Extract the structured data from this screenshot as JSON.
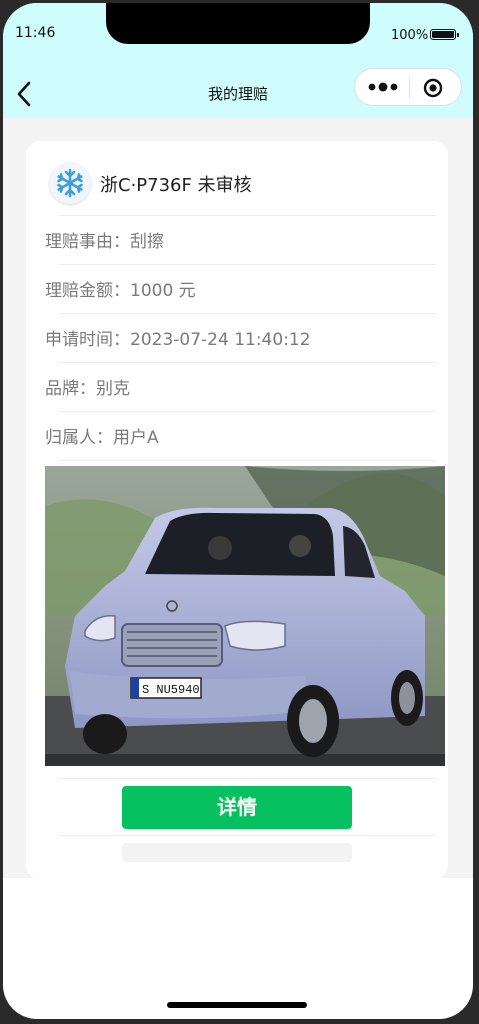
{
  "status_bar": {
    "time": "11:46",
    "battery": "100%"
  },
  "nav": {
    "title": "我的理赔",
    "back_icon": "chevron-left-icon",
    "more_icon": "more-dots-icon",
    "close_icon": "target-circle-icon",
    "bar_color": "#cffcfc"
  },
  "claim": {
    "plate_status": "浙C·P736F 未审核",
    "icon": "snowflake-icon",
    "fields": [
      {
        "label": "理赔事由：",
        "value": "刮擦"
      },
      {
        "label": "理赔金额：",
        "value": "1000 元"
      },
      {
        "label": "申请时间：",
        "value": "2023-07-24 11:40:12"
      },
      {
        "label": "品牌：",
        "value": "别克"
      },
      {
        "label": "归属人：",
        "value": "用户A"
      }
    ],
    "image_plate": "S NU5940",
    "detail_button": "详情",
    "button_color": "#07c160"
  }
}
